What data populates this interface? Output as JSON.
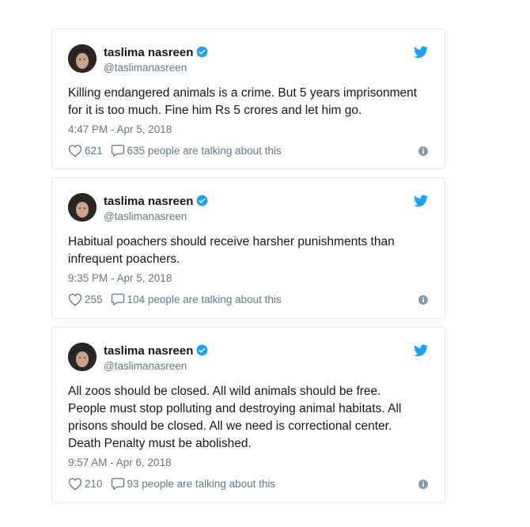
{
  "colors": {
    "accent": "#1da1f2",
    "muted": "#657786",
    "text": "#14171a",
    "border": "#e1e8ed"
  },
  "icons": {
    "verified": "verified-badge-icon",
    "twitter": "twitter-bird-icon",
    "like": "heart-icon",
    "reply": "speech-bubble-icon",
    "info": "info-icon"
  },
  "tweets": [
    {
      "name": "taslima nasreen",
      "handle": "@taslimanasreen",
      "text": "Killing endangered animals is a crime. But 5 years imprisonment\nfor it is too much. Fine him Rs 5 crores  and let him go.",
      "time": "4:47 PM - Apr 5, 2018",
      "likes": "621",
      "talking": "635 people are talking about this"
    },
    {
      "name": "taslima nasreen",
      "handle": "@taslimanasreen",
      "text": "Habitual poachers  should receive harsher  punishments than\ninfrequent poachers.",
      "time": "9:35 PM - Apr 5, 2018",
      "likes": "255",
      "talking": "104 people are talking about this"
    },
    {
      "name": "taslima nasreen",
      "handle": "@taslimanasreen",
      "text": "All zoos should be closed. All wild animals should be free.\nPeople must stop polluting and destroying animal habitats. All\nprisons  should be closed. All we need is  correctional center.\nDeath Penalty must be abolished.",
      "time": "9:57 AM - Apr 6, 2018",
      "likes": "210",
      "talking": "93 people are talking about this"
    }
  ]
}
